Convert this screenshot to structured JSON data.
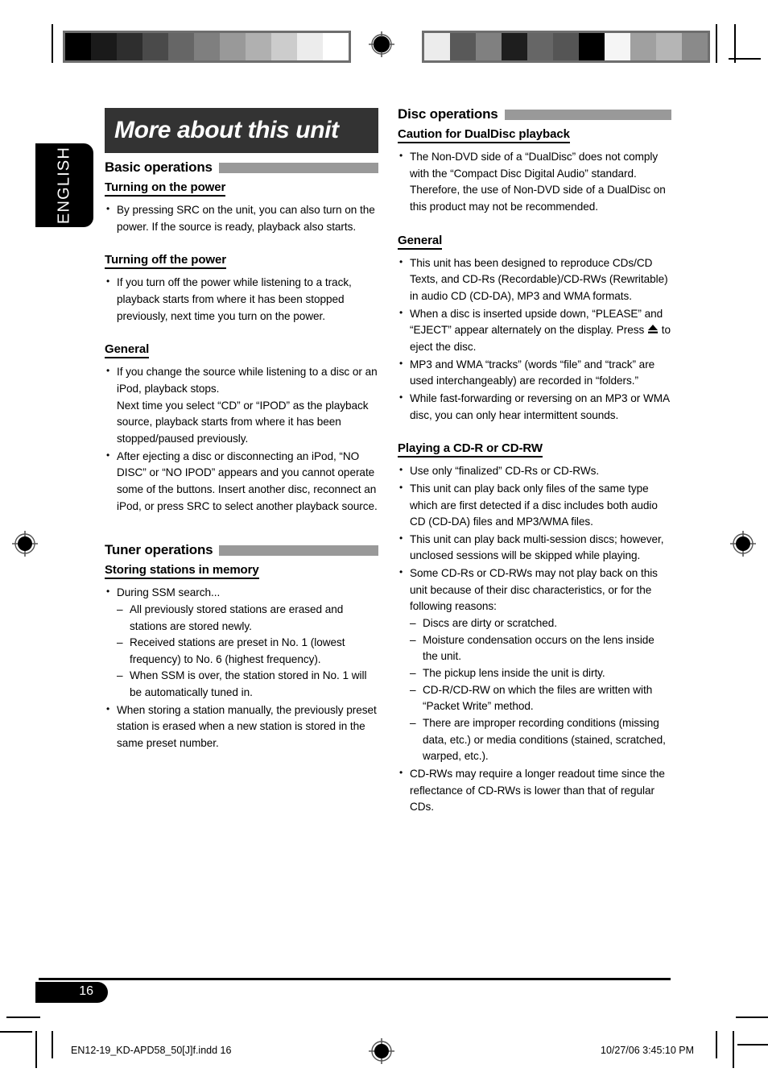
{
  "document": {
    "language_tab": "ENGLISH",
    "title": "More about this unit",
    "page_number": "16"
  },
  "footer": {
    "file_name": "EN12-19_KD-APD58_50[J]f.indd   16",
    "timestamp": "10/27/06   3:45:10 PM"
  },
  "calibration": {
    "left_swatches": [
      "#000000",
      "#1a1a1a",
      "#2e2e2e",
      "#4a4a4a",
      "#666666",
      "#7f7f7f",
      "#999999",
      "#b0b0b0",
      "#cccccc",
      "#ececec",
      "#ffffff"
    ],
    "right_swatches": [
      "#ececec",
      "#595959",
      "#808080",
      "#1e1e1e",
      "#666666",
      "#555555",
      "#000000",
      "#f5f5f5",
      "#a0a0a0",
      "#b5b5b5",
      "#8a8a8a"
    ]
  },
  "colors": {
    "banner": "#333333",
    "section_bar": "#999999",
    "badge": "#000000"
  },
  "left_column": {
    "sections": [
      {
        "heading": "Basic operations",
        "subsections": [
          {
            "heading": "Turning on the power",
            "bullets": [
              "By pressing SRC on the unit, you can also turn on the power. If the source is ready, playback also starts."
            ]
          },
          {
            "heading": "Turning off the power",
            "bullets": [
              "If you turn off the power while listening to a track, playback starts from where it has been stopped previously, next time you turn on the power."
            ]
          },
          {
            "heading": "General",
            "bullets": [
              "If you change the source while listening to a disc or an iPod, playback stops.",
              "After ejecting a disc or disconnecting an iPod, “NO DISC” or “NO IPOD” appears and you cannot operate some of the buttons. Insert another disc, reconnect an iPod, or press SRC to select another playback source."
            ],
            "bullet1_extra": "Next time you select “CD” or “IPOD” as the playback source, playback starts from where it has been stopped/paused previously."
          }
        ]
      },
      {
        "heading": "Tuner operations",
        "subsections": [
          {
            "heading": "Storing stations in memory",
            "bullets": [
              "During SSM search...",
              "When storing a station manually, the previously preset station is erased when a new station is stored in the same preset number."
            ],
            "sub_dashes": [
              "All previously stored stations are erased and stations are stored newly.",
              "Received stations are preset in No. 1 (lowest frequency) to No. 6 (highest frequency).",
              "When SSM is over, the station stored in No. 1 will be automatically tuned in."
            ]
          }
        ]
      }
    ]
  },
  "right_column": {
    "sections": [
      {
        "heading": "Disc operations",
        "subsections": [
          {
            "heading": "Caution for DualDisc playback",
            "bullets": [
              "The Non-DVD side of a “DualDisc” does not comply with the “Compact Disc Digital Audio” standard. Therefore, the use of Non-DVD side of a DualDisc on this product may not be recommended."
            ]
          },
          {
            "heading": "General",
            "bullets": [
              "This unit has been designed to reproduce CDs/CD Texts, and CD-Rs (Recordable)/CD-RWs (Rewritable) in audio CD (CD-DA), MP3 and WMA formats.",
              "MP3 and WMA “tracks” (words “file” and “track” are used interchangeably) are recorded in “folders.”",
              "While fast-forwarding or reversing on an MP3 or WMA disc, you can only hear intermittent sounds."
            ],
            "eject_bullet": {
              "before": "When a disc is inserted upside down, “PLEASE” and “EJECT” appear alternately on the display. Press ",
              "icon": "eject-icon",
              "after": " to eject the disc."
            }
          },
          {
            "heading": "Playing a CD-R or CD-RW",
            "bullets": [
              "Use only “finalized” CD-Rs or CD-RWs.",
              "This unit can play back only files of the same type which are first detected if a disc includes both audio CD (CD-DA) files and MP3/WMA files.",
              "This unit can play back multi-session discs; however, unclosed sessions will be skipped while playing.",
              "Some CD-Rs or CD-RWs may not play back on this unit because of their disc characteristics, or for the following reasons:",
              "CD-RWs may require a longer readout time since the reflectance of CD-RWs is lower than that of regular CDs."
            ],
            "sub_dashes": [
              "Discs are dirty or scratched.",
              "Moisture condensation occurs on the lens inside the unit.",
              "The pickup lens inside the unit is dirty.",
              "CD-R/CD-RW on which the files are written with “Packet Write” method.",
              "There are improper recording conditions (missing data, etc.) or media conditions (stained, scratched, warped, etc.)."
            ]
          }
        ]
      }
    ]
  }
}
